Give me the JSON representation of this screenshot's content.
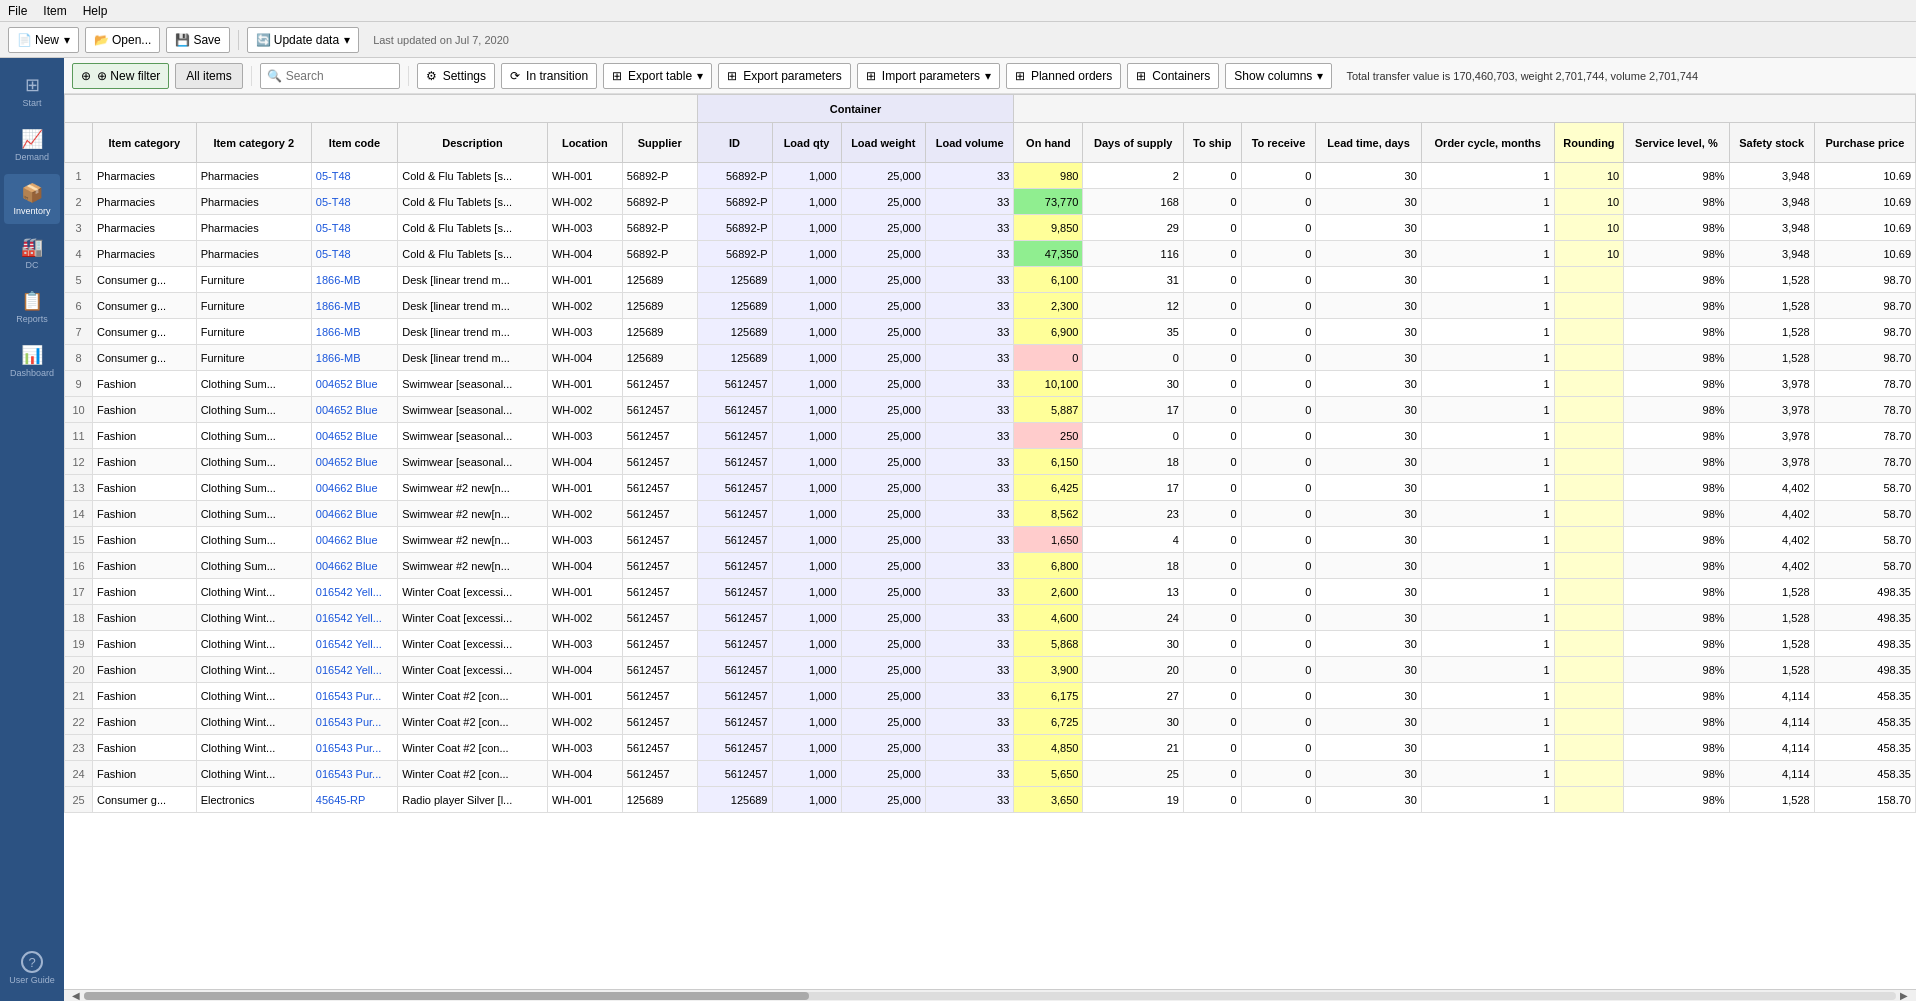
{
  "menubar": {
    "items": [
      "File",
      "Item",
      "Help"
    ]
  },
  "toolbar": {
    "new_label": "New",
    "open_label": "Open...",
    "save_label": "Save",
    "update_label": "Update data",
    "last_updated": "Last updated on Jul 7, 2020"
  },
  "sidebar": {
    "items": [
      {
        "id": "start",
        "label": "Start",
        "icon": "⊞"
      },
      {
        "id": "demand",
        "label": "Demand",
        "icon": "📈"
      },
      {
        "id": "inventory",
        "label": "Inventory",
        "icon": "📦"
      },
      {
        "id": "dc",
        "label": "DC",
        "icon": "🏭"
      },
      {
        "id": "reports",
        "label": "Reports",
        "icon": "📋"
      },
      {
        "id": "dashboard",
        "label": "Dashboard",
        "icon": "📊"
      }
    ],
    "bottom": [
      {
        "id": "user-guide",
        "label": "User Guide",
        "icon": "?"
      }
    ]
  },
  "action_bar": {
    "new_filter": "⊕ New filter",
    "all_items": "All items",
    "search_placeholder": "Search",
    "settings": "⚙ Settings",
    "in_transition": "⟳ In transition",
    "export_table": "⊞ Export table",
    "export_params": "⊞ Export parameters",
    "import_params": "⊞ Import parameters",
    "planned_orders": "⊞ Planned orders",
    "containers": "⊞ Containers",
    "show_columns": "Show columns ▾",
    "status_text": "Total transfer value is 170,460,703, weight 2,701,744, volume 2,701,744"
  },
  "table": {
    "group_header": "Container",
    "columns": [
      {
        "id": "row",
        "label": "#"
      },
      {
        "id": "item_cat",
        "label": "Item category"
      },
      {
        "id": "item_cat2",
        "label": "Item category 2"
      },
      {
        "id": "item_code",
        "label": "Item code"
      },
      {
        "id": "desc",
        "label": "Description"
      },
      {
        "id": "loc",
        "label": "Location"
      },
      {
        "id": "sup",
        "label": "Supplier"
      },
      {
        "id": "con_id",
        "label": "ID"
      },
      {
        "id": "load_qty",
        "label": "Load qty"
      },
      {
        "id": "load_wt",
        "label": "Load weight"
      },
      {
        "id": "load_vol",
        "label": "Load volume"
      },
      {
        "id": "on_hand",
        "label": "On hand"
      },
      {
        "id": "days_supply",
        "label": "Days of supply"
      },
      {
        "id": "to_ship",
        "label": "To ship"
      },
      {
        "id": "to_receive",
        "label": "To receive"
      },
      {
        "id": "lead_time",
        "label": "Lead time, days"
      },
      {
        "id": "order_cycle",
        "label": "Order cycle, months"
      },
      {
        "id": "rounding",
        "label": "Rounding"
      },
      {
        "id": "service_level",
        "label": "Service level, %"
      },
      {
        "id": "safety_stock",
        "label": "Safety stock"
      },
      {
        "id": "purchase_price",
        "label": "Purchase price"
      }
    ],
    "rows": [
      {
        "row": 1,
        "cat": "Pharmacies",
        "cat2": "Pharmacies",
        "code": "05-T48",
        "desc": "Cold & Flu Tablets [s...",
        "loc": "WH-001",
        "sup": "56892-P",
        "con_id": "56892-P",
        "load_qty": 1000,
        "load_wt": 25000,
        "load_vol": 33,
        "on_hand": 980,
        "days": 2,
        "to_ship": 0,
        "to_recv": 0,
        "lead": 30,
        "order": 1,
        "round": 10,
        "svc": "98%",
        "safety": 3948,
        "price": "10.69",
        "on_hand_class": "onhand-yellow"
      },
      {
        "row": 2,
        "cat": "Pharmacies",
        "cat2": "Pharmacies",
        "code": "05-T48",
        "desc": "Cold & Flu Tablets [s...",
        "loc": "WH-002",
        "sup": "56892-P",
        "con_id": "56892-P",
        "load_qty": 1000,
        "load_wt": 25000,
        "load_vol": 33,
        "on_hand": 73770,
        "days": 168,
        "to_ship": 0,
        "to_recv": 0,
        "lead": 30,
        "order": 1,
        "round": 10,
        "svc": "98%",
        "safety": 3948,
        "price": "10.69",
        "on_hand_class": "onhand-green"
      },
      {
        "row": 3,
        "cat": "Pharmacies",
        "cat2": "Pharmacies",
        "code": "05-T48",
        "desc": "Cold & Flu Tablets [s...",
        "loc": "WH-003",
        "sup": "56892-P",
        "con_id": "56892-P",
        "load_qty": 1000,
        "load_wt": 25000,
        "load_vol": 33,
        "on_hand": 9850,
        "days": 29,
        "to_ship": 0,
        "to_recv": 0,
        "lead": 30,
        "order": 1,
        "round": 10,
        "svc": "98%",
        "safety": 3948,
        "price": "10.69",
        "on_hand_class": "onhand-yellow"
      },
      {
        "row": 4,
        "cat": "Pharmacies",
        "cat2": "Pharmacies",
        "code": "05-T48",
        "desc": "Cold & Flu Tablets [s...",
        "loc": "WH-004",
        "sup": "56892-P",
        "con_id": "56892-P",
        "load_qty": 1000,
        "load_wt": 25000,
        "load_vol": 33,
        "on_hand": 47350,
        "days": 116,
        "to_ship": 0,
        "to_recv": 0,
        "lead": 30,
        "order": 1,
        "round": 10,
        "svc": "98%",
        "safety": 3948,
        "price": "10.69",
        "on_hand_class": "onhand-green"
      },
      {
        "row": 5,
        "cat": "Consumer g...",
        "cat2": "Furniture",
        "code": "1866-MB",
        "desc": "Desk [linear trend m...",
        "loc": "WH-001",
        "sup": "125689",
        "con_id": "125689",
        "load_qty": 1000,
        "load_wt": 25000,
        "load_vol": 33,
        "on_hand": 6100,
        "days": 31,
        "to_ship": 0,
        "to_recv": 0,
        "lead": 30,
        "order": 1,
        "round": "",
        "svc": "98%",
        "safety": 1528,
        "price": "98.70",
        "on_hand_class": "onhand-yellow"
      },
      {
        "row": 6,
        "cat": "Consumer g...",
        "cat2": "Furniture",
        "code": "1866-MB",
        "desc": "Desk [linear trend m...",
        "loc": "WH-002",
        "sup": "125689",
        "con_id": "125689",
        "load_qty": 1000,
        "load_wt": 25000,
        "load_vol": 33,
        "on_hand": 2300,
        "days": 12,
        "to_ship": 0,
        "to_recv": 0,
        "lead": 30,
        "order": 1,
        "round": "",
        "svc": "98%",
        "safety": 1528,
        "price": "98.70",
        "on_hand_class": "onhand-yellow"
      },
      {
        "row": 7,
        "cat": "Consumer g...",
        "cat2": "Furniture",
        "code": "1866-MB",
        "desc": "Desk [linear trend m...",
        "loc": "WH-003",
        "sup": "125689",
        "con_id": "125689",
        "load_qty": 1000,
        "load_wt": 25000,
        "load_vol": 33,
        "on_hand": 6900,
        "days": 35,
        "to_ship": 0,
        "to_recv": 0,
        "lead": 30,
        "order": 1,
        "round": "",
        "svc": "98%",
        "safety": 1528,
        "price": "98.70",
        "on_hand_class": "onhand-yellow"
      },
      {
        "row": 8,
        "cat": "Consumer g...",
        "cat2": "Furniture",
        "code": "1866-MB",
        "desc": "Desk [linear trend m...",
        "loc": "WH-004",
        "sup": "125689",
        "con_id": "125689",
        "load_qty": 1000,
        "load_wt": 25000,
        "load_vol": 33,
        "on_hand": 0,
        "days": 0,
        "to_ship": 0,
        "to_recv": 0,
        "lead": 30,
        "order": 1,
        "round": "",
        "svc": "98%",
        "safety": 1528,
        "price": "98.70",
        "on_hand_class": "onhand-pink"
      },
      {
        "row": 9,
        "cat": "Fashion",
        "cat2": "Clothing Sum...",
        "code": "004652 Blue",
        "desc": "Swimwear [seasonal...",
        "loc": "WH-001",
        "sup": "5612457",
        "con_id": "5612457",
        "load_qty": 1000,
        "load_wt": 25000,
        "load_vol": 33,
        "on_hand": 10100,
        "days": 30,
        "to_ship": 0,
        "to_recv": 0,
        "lead": 30,
        "order": 1,
        "round": "",
        "svc": "98%",
        "safety": 3978,
        "price": "78.70",
        "on_hand_class": "onhand-yellow"
      },
      {
        "row": 10,
        "cat": "Fashion",
        "cat2": "Clothing Sum...",
        "code": "004652 Blue",
        "desc": "Swimwear [seasonal...",
        "loc": "WH-002",
        "sup": "5612457",
        "con_id": "5612457",
        "load_qty": 1000,
        "load_wt": 25000,
        "load_vol": 33,
        "on_hand": 5887,
        "days": 17,
        "to_ship": 0,
        "to_recv": 0,
        "lead": 30,
        "order": 1,
        "round": "",
        "svc": "98%",
        "safety": 3978,
        "price": "78.70",
        "on_hand_class": "onhand-yellow"
      },
      {
        "row": 11,
        "cat": "Fashion",
        "cat2": "Clothing Sum...",
        "code": "004652 Blue",
        "desc": "Swimwear [seasonal...",
        "loc": "WH-003",
        "sup": "5612457",
        "con_id": "5612457",
        "load_qty": 1000,
        "load_wt": 25000,
        "load_vol": 33,
        "on_hand": 250,
        "days": 0,
        "to_ship": 0,
        "to_recv": 0,
        "lead": 30,
        "order": 1,
        "round": "",
        "svc": "98%",
        "safety": 3978,
        "price": "78.70",
        "on_hand_class": "onhand-pink"
      },
      {
        "row": 12,
        "cat": "Fashion",
        "cat2": "Clothing Sum...",
        "code": "004652 Blue",
        "desc": "Swimwear [seasonal...",
        "loc": "WH-004",
        "sup": "5612457",
        "con_id": "5612457",
        "load_qty": 1000,
        "load_wt": 25000,
        "load_vol": 33,
        "on_hand": 6150,
        "days": 18,
        "to_ship": 0,
        "to_recv": 0,
        "lead": 30,
        "order": 1,
        "round": "",
        "svc": "98%",
        "safety": 3978,
        "price": "78.70",
        "on_hand_class": "onhand-yellow"
      },
      {
        "row": 13,
        "cat": "Fashion",
        "cat2": "Clothing Sum...",
        "code": "004662 Blue",
        "desc": "Swimwear #2 new[n...",
        "loc": "WH-001",
        "sup": "5612457",
        "con_id": "5612457",
        "load_qty": 1000,
        "load_wt": 25000,
        "load_vol": 33,
        "on_hand": 6425,
        "days": 17,
        "to_ship": 0,
        "to_recv": 0,
        "lead": 30,
        "order": 1,
        "round": "",
        "svc": "98%",
        "safety": 4402,
        "price": "58.70",
        "on_hand_class": "onhand-yellow"
      },
      {
        "row": 14,
        "cat": "Fashion",
        "cat2": "Clothing Sum...",
        "code": "004662 Blue",
        "desc": "Swimwear #2 new[n...",
        "loc": "WH-002",
        "sup": "5612457",
        "con_id": "5612457",
        "load_qty": 1000,
        "load_wt": 25000,
        "load_vol": 33,
        "on_hand": 8562,
        "days": 23,
        "to_ship": 0,
        "to_recv": 0,
        "lead": 30,
        "order": 1,
        "round": "",
        "svc": "98%",
        "safety": 4402,
        "price": "58.70",
        "on_hand_class": "onhand-yellow"
      },
      {
        "row": 15,
        "cat": "Fashion",
        "cat2": "Clothing Sum...",
        "code": "004662 Blue",
        "desc": "Swimwear #2 new[n...",
        "loc": "WH-003",
        "sup": "5612457",
        "con_id": "5612457",
        "load_qty": 1000,
        "load_wt": 25000,
        "load_vol": 33,
        "on_hand": 1650,
        "days": 4,
        "to_ship": 0,
        "to_recv": 0,
        "lead": 30,
        "order": 1,
        "round": "",
        "svc": "98%",
        "safety": 4402,
        "price": "58.70",
        "on_hand_class": "onhand-pink"
      },
      {
        "row": 16,
        "cat": "Fashion",
        "cat2": "Clothing Sum...",
        "code": "004662 Blue",
        "desc": "Swimwear #2 new[n...",
        "loc": "WH-004",
        "sup": "5612457",
        "con_id": "5612457",
        "load_qty": 1000,
        "load_wt": 25000,
        "load_vol": 33,
        "on_hand": 6800,
        "days": 18,
        "to_ship": 0,
        "to_recv": 0,
        "lead": 30,
        "order": 1,
        "round": "",
        "svc": "98%",
        "safety": 4402,
        "price": "58.70",
        "on_hand_class": "onhand-yellow"
      },
      {
        "row": 17,
        "cat": "Fashion",
        "cat2": "Clothing Wint...",
        "code": "016542 Yell...",
        "desc": "Winter Coat [excessi...",
        "loc": "WH-001",
        "sup": "5612457",
        "con_id": "5612457",
        "load_qty": 1000,
        "load_wt": 25000,
        "load_vol": 33,
        "on_hand": 2600,
        "days": 13,
        "to_ship": 0,
        "to_recv": 0,
        "lead": 30,
        "order": 1,
        "round": "",
        "svc": "98%",
        "safety": 1528,
        "price": "498.35",
        "on_hand_class": "onhand-yellow"
      },
      {
        "row": 18,
        "cat": "Fashion",
        "cat2": "Clothing Wint...",
        "code": "016542 Yell...",
        "desc": "Winter Coat [excessi...",
        "loc": "WH-002",
        "sup": "5612457",
        "con_id": "5612457",
        "load_qty": 1000,
        "load_wt": 25000,
        "load_vol": 33,
        "on_hand": 4600,
        "days": 24,
        "to_ship": 0,
        "to_recv": 0,
        "lead": 30,
        "order": 1,
        "round": "",
        "svc": "98%",
        "safety": 1528,
        "price": "498.35",
        "on_hand_class": "onhand-yellow"
      },
      {
        "row": 19,
        "cat": "Fashion",
        "cat2": "Clothing Wint...",
        "code": "016542 Yell...",
        "desc": "Winter Coat [excessi...",
        "loc": "WH-003",
        "sup": "5612457",
        "con_id": "5612457",
        "load_qty": 1000,
        "load_wt": 25000,
        "load_vol": 33,
        "on_hand": 5868,
        "days": 30,
        "to_ship": 0,
        "to_recv": 0,
        "lead": 30,
        "order": 1,
        "round": "",
        "svc": "98%",
        "safety": 1528,
        "price": "498.35",
        "on_hand_class": "onhand-yellow"
      },
      {
        "row": 20,
        "cat": "Fashion",
        "cat2": "Clothing Wint...",
        "code": "016542 Yell...",
        "desc": "Winter Coat [excessi...",
        "loc": "WH-004",
        "sup": "5612457",
        "con_id": "5612457",
        "load_qty": 1000,
        "load_wt": 25000,
        "load_vol": 33,
        "on_hand": 3900,
        "days": 20,
        "to_ship": 0,
        "to_recv": 0,
        "lead": 30,
        "order": 1,
        "round": "",
        "svc": "98%",
        "safety": 1528,
        "price": "498.35",
        "on_hand_class": "onhand-yellow"
      },
      {
        "row": 21,
        "cat": "Fashion",
        "cat2": "Clothing Wint...",
        "code": "016543 Pur...",
        "desc": "Winter Coat #2 [con...",
        "loc": "WH-001",
        "sup": "5612457",
        "con_id": "5612457",
        "load_qty": 1000,
        "load_wt": 25000,
        "load_vol": 33,
        "on_hand": 6175,
        "days": 27,
        "to_ship": 0,
        "to_recv": 0,
        "lead": 30,
        "order": 1,
        "round": "",
        "svc": "98%",
        "safety": 4114,
        "price": "458.35",
        "on_hand_class": "onhand-yellow"
      },
      {
        "row": 22,
        "cat": "Fashion",
        "cat2": "Clothing Wint...",
        "code": "016543 Pur...",
        "desc": "Winter Coat #2 [con...",
        "loc": "WH-002",
        "sup": "5612457",
        "con_id": "5612457",
        "load_qty": 1000,
        "load_wt": 25000,
        "load_vol": 33,
        "on_hand": 6725,
        "days": 30,
        "to_ship": 0,
        "to_recv": 0,
        "lead": 30,
        "order": 1,
        "round": "",
        "svc": "98%",
        "safety": 4114,
        "price": "458.35",
        "on_hand_class": "onhand-yellow"
      },
      {
        "row": 23,
        "cat": "Fashion",
        "cat2": "Clothing Wint...",
        "code": "016543 Pur...",
        "desc": "Winter Coat #2 [con...",
        "loc": "WH-003",
        "sup": "5612457",
        "con_id": "5612457",
        "load_qty": 1000,
        "load_wt": 25000,
        "load_vol": 33,
        "on_hand": 4850,
        "days": 21,
        "to_ship": 0,
        "to_recv": 0,
        "lead": 30,
        "order": 1,
        "round": "",
        "svc": "98%",
        "safety": 4114,
        "price": "458.35",
        "on_hand_class": "onhand-yellow"
      },
      {
        "row": 24,
        "cat": "Fashion",
        "cat2": "Clothing Wint...",
        "code": "016543 Pur...",
        "desc": "Winter Coat #2 [con...",
        "loc": "WH-004",
        "sup": "5612457",
        "con_id": "5612457",
        "load_qty": 1000,
        "load_wt": 25000,
        "load_vol": 33,
        "on_hand": 5650,
        "days": 25,
        "to_ship": 0,
        "to_recv": 0,
        "lead": 30,
        "order": 1,
        "round": "",
        "svc": "98%",
        "safety": 4114,
        "price": "458.35",
        "on_hand_class": "onhand-yellow"
      },
      {
        "row": 25,
        "cat": "Consumer g...",
        "cat2": "Electronics",
        "code": "45645-RP",
        "desc": "Radio player Silver [l...",
        "loc": "WH-001",
        "sup": "125689",
        "con_id": "125689",
        "load_qty": 1000,
        "load_wt": 25000,
        "load_vol": 33,
        "on_hand": 3650,
        "days": 19,
        "to_ship": 0,
        "to_recv": 0,
        "lead": 30,
        "order": 1,
        "round": "",
        "svc": "98%",
        "safety": 1528,
        "price": "158.70",
        "on_hand_class": "onhand-yellow"
      }
    ]
  }
}
